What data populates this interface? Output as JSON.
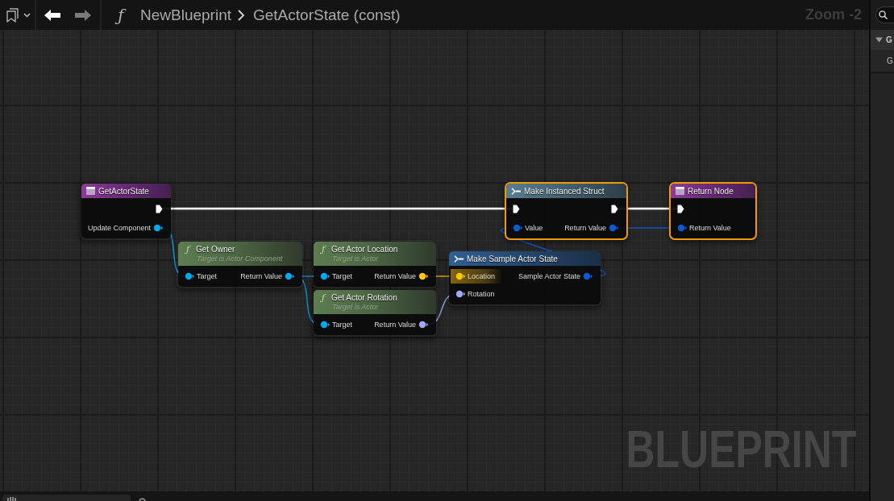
{
  "toolbar": {
    "back": {
      "disabled": false
    },
    "forward": {
      "disabled": true
    },
    "function_icon": "ƒ",
    "breadcrumb": [
      "NewBlueprint",
      "GetActorState (const)"
    ],
    "zoom": "Zoom -2"
  },
  "graph": {
    "nodes": [
      {
        "kind": "entry",
        "title": "GetActorState",
        "selected": false,
        "outputs": [
          {
            "kind": "exec",
            "highlighted": false
          },
          {
            "kind": "object",
            "label": "Update Component",
            "highlighted": false
          }
        ]
      },
      {
        "kind": "function",
        "icon": "ƒ",
        "title": "Get Owner",
        "subtitle": "Target is Actor Component",
        "selected": false,
        "inputs": [
          {
            "kind": "object",
            "label": "Target",
            "highlighted": false
          }
        ],
        "outputs": [
          {
            "kind": "object",
            "label": "Return Value",
            "highlighted": false
          }
        ]
      },
      {
        "kind": "function",
        "icon": "ƒ",
        "title": "Get Actor Location",
        "subtitle": "Target is Actor",
        "selected": false,
        "inputs": [
          {
            "kind": "object",
            "label": "Target",
            "highlighted": false
          }
        ],
        "outputs": [
          {
            "kind": "vector",
            "label": "Return Value",
            "highlighted": false
          }
        ]
      },
      {
        "kind": "function",
        "icon": "ƒ",
        "title": "Get Actor Rotation",
        "subtitle": "Target is Actor",
        "selected": false,
        "inputs": [
          {
            "kind": "object",
            "label": "Target",
            "highlighted": false
          }
        ],
        "outputs": [
          {
            "kind": "rotator",
            "label": "Return Value",
            "highlighted": false
          }
        ]
      },
      {
        "kind": "make_struct",
        "title": "Make Sample Actor State",
        "selected": false,
        "inputs": [
          {
            "kind": "vector",
            "label": "Location",
            "highlighted": true
          },
          {
            "kind": "rotator",
            "label": "Rotation",
            "highlighted": false
          }
        ],
        "outputs": [
          {
            "kind": "struct",
            "label": "Sample Actor State",
            "highlighted": false
          }
        ]
      },
      {
        "kind": "callable",
        "title": "Make Instanced Struct",
        "selected": true,
        "inputs": [
          {
            "kind": "exec",
            "highlighted": false
          },
          {
            "kind": "struct",
            "label": "Value",
            "highlighted": false
          }
        ],
        "outputs": [
          {
            "kind": "exec",
            "highlighted": false
          },
          {
            "kind": "struct",
            "label": "Return Value",
            "highlighted": false
          }
        ]
      },
      {
        "kind": "result",
        "title": "Return Node",
        "selected": true,
        "inputs": [
          {
            "kind": "exec",
            "highlighted": false
          },
          {
            "kind": "struct",
            "label": "Return Value",
            "highlighted": false
          }
        ]
      }
    ],
    "corner_label": "BLUEPRINT"
  },
  "details_panel": {
    "sections": [
      {
        "title": "G",
        "expanded": true,
        "rows": [
          "G"
        ]
      }
    ]
  }
}
